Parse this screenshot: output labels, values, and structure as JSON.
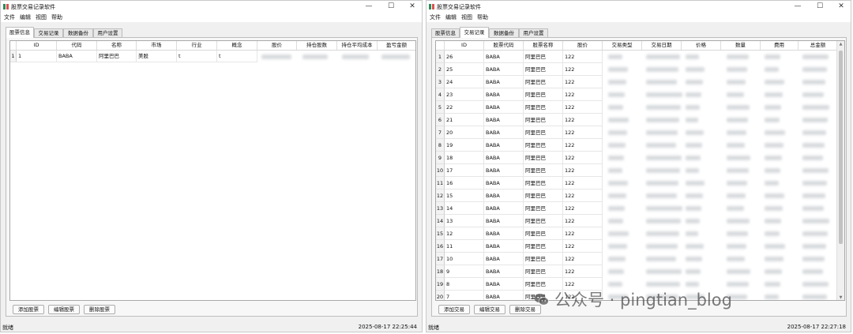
{
  "left_window": {
    "title": "股票交易记录软件",
    "controls": {
      "minimize": "—",
      "maximize": "☐",
      "close": "✕"
    },
    "menu": [
      "文件",
      "编辑",
      "视图",
      "帮助"
    ],
    "tabs": [
      "股票信息",
      "交易记录",
      "数据备份",
      "用户设置"
    ],
    "active_tab": 0,
    "table": {
      "columns": [
        "ID",
        "代码",
        "名称",
        "市场",
        "行业",
        "概念",
        "股价",
        "持仓股数",
        "持仓平均成本",
        "盈亏金额"
      ],
      "rows": [
        {
          "num": "1",
          "cells": [
            "1",
            "BABA",
            "阿里巴巴",
            "美股",
            "t",
            "t"
          ]
        }
      ]
    },
    "buttons": [
      "添加股票",
      "编辑股票",
      "删除股票"
    ],
    "status": "就绪",
    "timestamp": "2025-08-17 22:25:44"
  },
  "right_window": {
    "title": "股票交易记录软件",
    "controls": {
      "minimize": "—",
      "maximize": "☐",
      "close": "✕"
    },
    "menu": [
      "文件",
      "编辑",
      "视图",
      "帮助"
    ],
    "tabs": [
      "股票信息",
      "交易记录",
      "数据备份",
      "用户设置"
    ],
    "active_tab": 1,
    "table": {
      "columns": [
        "ID",
        "股票代码",
        "股票名称",
        "股价",
        "交易类型",
        "交易日期",
        "价格",
        "数量",
        "费用",
        "总金额"
      ],
      "rows": [
        {
          "num": "1",
          "cells": [
            "26",
            "BABA",
            "阿里巴巴",
            "122"
          ]
        },
        {
          "num": "2",
          "cells": [
            "25",
            "BABA",
            "阿里巴巴",
            "122"
          ]
        },
        {
          "num": "3",
          "cells": [
            "24",
            "BABA",
            "阿里巴巴",
            "122"
          ]
        },
        {
          "num": "4",
          "cells": [
            "23",
            "BABA",
            "阿里巴巴",
            "122"
          ]
        },
        {
          "num": "5",
          "cells": [
            "22",
            "BABA",
            "阿里巴巴",
            "122"
          ]
        },
        {
          "num": "6",
          "cells": [
            "21",
            "BABA",
            "阿里巴巴",
            "122"
          ]
        },
        {
          "num": "7",
          "cells": [
            "20",
            "BABA",
            "阿里巴巴",
            "122"
          ]
        },
        {
          "num": "8",
          "cells": [
            "19",
            "BABA",
            "阿里巴巴",
            "122"
          ]
        },
        {
          "num": "9",
          "cells": [
            "18",
            "BABA",
            "阿里巴巴",
            "122"
          ]
        },
        {
          "num": "10",
          "cells": [
            "17",
            "BABA",
            "阿里巴巴",
            "122"
          ]
        },
        {
          "num": "11",
          "cells": [
            "16",
            "BABA",
            "阿里巴巴",
            "122"
          ]
        },
        {
          "num": "12",
          "cells": [
            "15",
            "BABA",
            "阿里巴巴",
            "122"
          ]
        },
        {
          "num": "13",
          "cells": [
            "14",
            "BABA",
            "阿里巴巴",
            "122"
          ]
        },
        {
          "num": "14",
          "cells": [
            "13",
            "BABA",
            "阿里巴巴",
            "122"
          ]
        },
        {
          "num": "15",
          "cells": [
            "12",
            "BABA",
            "阿里巴巴",
            "122"
          ]
        },
        {
          "num": "16",
          "cells": [
            "11",
            "BABA",
            "阿里巴巴",
            "122"
          ]
        },
        {
          "num": "17",
          "cells": [
            "10",
            "BABA",
            "阿里巴巴",
            "122"
          ]
        },
        {
          "num": "18",
          "cells": [
            "9",
            "BABA",
            "阿里巴巴",
            "122"
          ]
        },
        {
          "num": "19",
          "cells": [
            "8",
            "BABA",
            "阿里巴巴",
            "122"
          ]
        },
        {
          "num": "20",
          "cells": [
            "7",
            "BABA",
            "阿里巴巴",
            "122"
          ]
        }
      ]
    },
    "buttons": [
      "添加交易",
      "编辑交易",
      "删除交易"
    ],
    "status": "就绪",
    "timestamp": "2025-08-17 22:27:18"
  },
  "watermark": {
    "text": "公众号 · pingtian_blog",
    "icon": "wechat-icon"
  }
}
